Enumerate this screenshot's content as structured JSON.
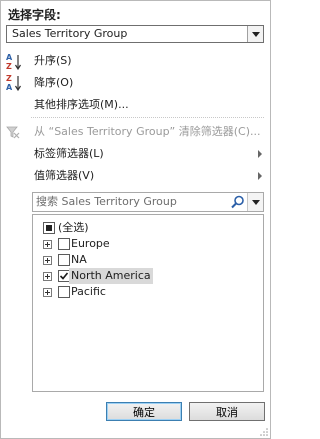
{
  "field": {
    "title": "选择字段:",
    "selected": "Sales Territory Group"
  },
  "menu": {
    "sort_asc": "升序(S)",
    "sort_desc": "降序(O)",
    "more_sort": "其他排序选项(M)...",
    "clear_filter": "从 “Sales Territory Group” 清除筛选器(C)...",
    "label_filter": "标签筛选器(L)",
    "value_filter": "值筛选器(V)"
  },
  "search": {
    "placeholder": "搜索 Sales Territory Group"
  },
  "list": {
    "select_all": "(全选)",
    "items": [
      {
        "label": "Europe",
        "checked": false
      },
      {
        "label": "NA",
        "checked": false
      },
      {
        "label": "North America",
        "checked": true
      },
      {
        "label": "Pacific",
        "checked": false
      }
    ]
  },
  "buttons": {
    "ok": "确定",
    "cancel": "取消"
  },
  "icons": {
    "sort_asc": "sort-az-icon",
    "sort_desc": "sort-za-icon",
    "clear": "clear-filter-icon",
    "search": "search-icon"
  }
}
